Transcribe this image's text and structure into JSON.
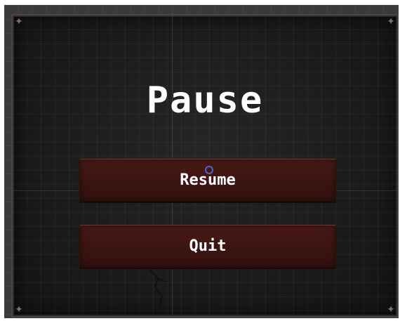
{
  "pause_menu": {
    "title": "Pause",
    "buttons": {
      "resume_label": "Resume",
      "quit_label": "Quit"
    }
  },
  "colors": {
    "panel_background": "#1b1b1b",
    "button_fill": "#3d1512",
    "title_text": "#ffffff",
    "cursor_ring": "#4d64c8"
  },
  "icons": {
    "corner": "corner-ornament-icon",
    "cursor": "cursor-ring-icon"
  }
}
